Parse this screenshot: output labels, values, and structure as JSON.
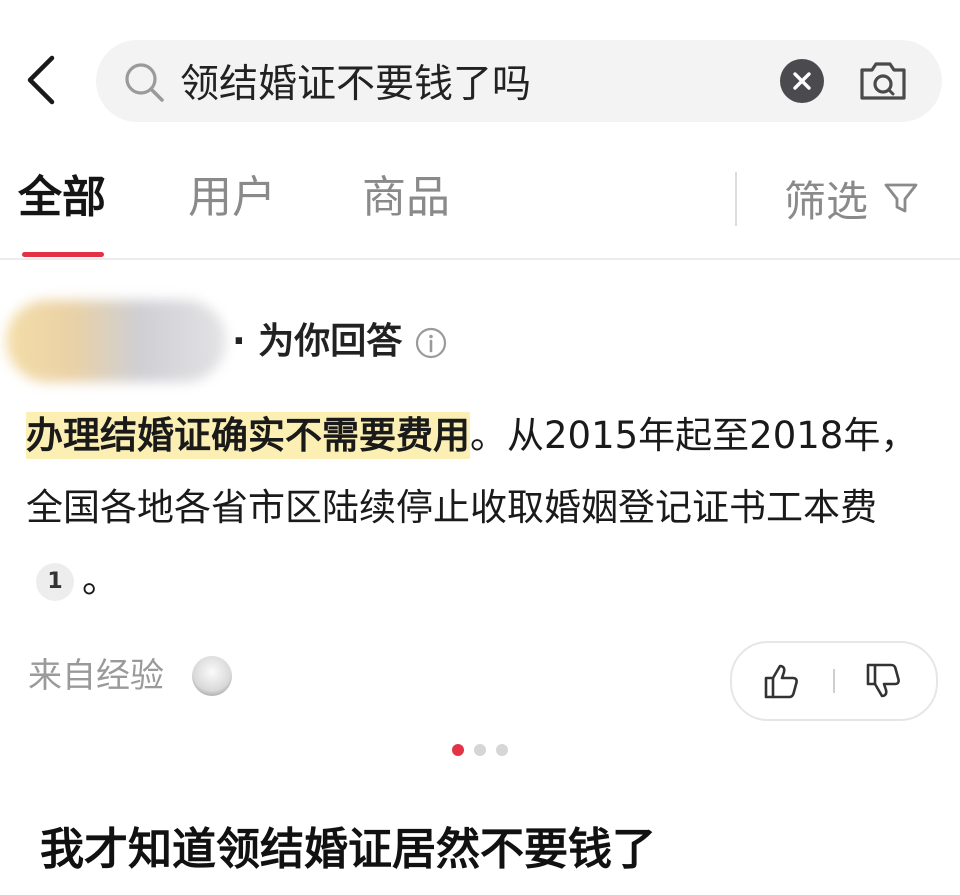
{
  "search": {
    "query": "领结婚证不要钱了吗"
  },
  "tabs": [
    {
      "label": "全部",
      "active": true
    },
    {
      "label": "用户",
      "active": false
    },
    {
      "label": "商品",
      "active": false
    }
  ],
  "filter": {
    "label": "筛选"
  },
  "answer": {
    "tag": "· 为你回答",
    "highlight": "办理结婚证确实不需要费用",
    "body": "。从2015年起至2018年，全国各地各省市区陆续停止收取婚姻登记证书工本费",
    "citation": "1",
    "tail": "。",
    "source_label": "来自经验"
  },
  "carousel": {
    "count": 3,
    "active_index": 0
  },
  "caption": "我才知道领结婚证居然不要钱了",
  "colors": {
    "accent": "#e23346",
    "highlight": "#fbefb4"
  },
  "icons": [
    "back-arrow-icon",
    "search-icon",
    "clear-icon",
    "camera-icon",
    "filter-funnel-icon",
    "info-icon",
    "thumb-up-icon",
    "thumb-down-icon"
  ]
}
